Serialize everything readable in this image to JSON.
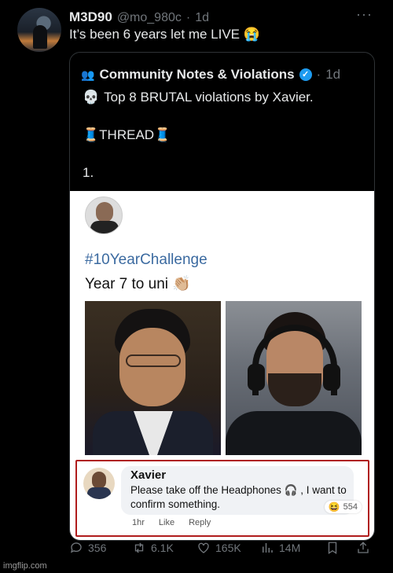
{
  "tweet": {
    "name": "M3D90",
    "handle": "@mo_980c",
    "separator": "·",
    "time": "1d",
    "more_label": "···",
    "text": "It’s been 6 years let me LIVE 😭"
  },
  "quote": {
    "icon": "👥",
    "account_name": "Community Notes & Violations",
    "verified_mark": "✓",
    "separator": "·",
    "time": "1d",
    "line1_emoji": "💀",
    "line1_text": "Top 8 BRUTAL violations by Xavier.",
    "thread_emoji_left": "🧵",
    "thread_label": "THREAD",
    "thread_emoji_right": "🧵",
    "numbering": "1."
  },
  "card": {
    "hashtag": "#10YearChallenge",
    "caption": "Year 7 to uni 👏🏼"
  },
  "comment": {
    "name": "Xavier",
    "text": "Please take off the Headphones 🎧 , I want to confirm something.",
    "reaction_emoji": "😆",
    "reaction_count": "554",
    "time": "1hr",
    "like_label": "Like",
    "reply_label": "Reply"
  },
  "actions": {
    "replies": "356",
    "retweets": "6.1K",
    "likes": "165K",
    "views": "14M"
  },
  "watermark": "imgflip.com",
  "colors": {
    "background": "#000000",
    "verified": "#1d9bf0",
    "muted": "#71767b",
    "highlight_border": "#b01c1c",
    "hashtag": "#3b6aa0"
  }
}
